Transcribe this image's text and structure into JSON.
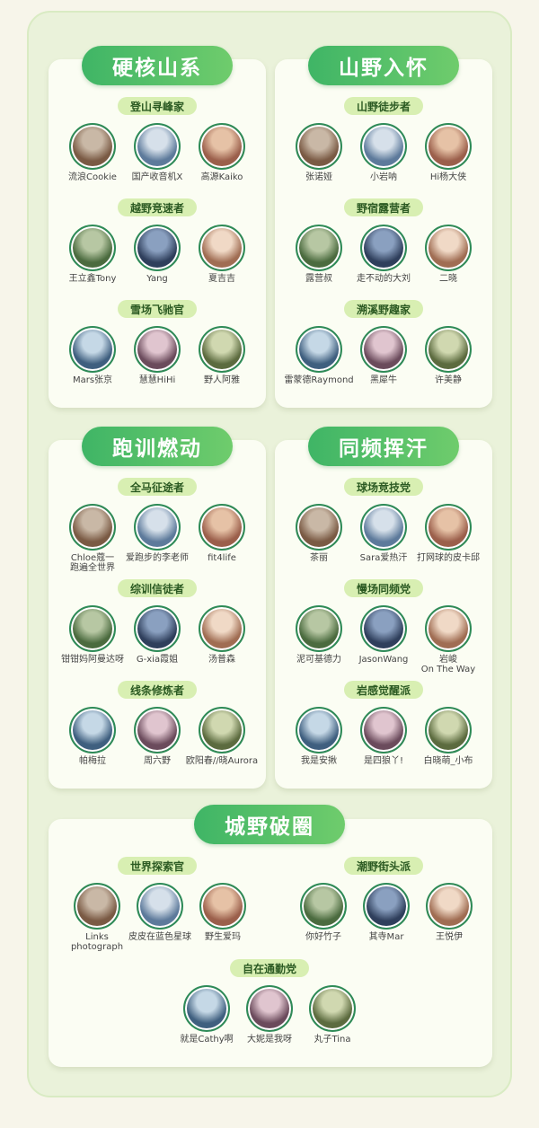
{
  "sections": [
    {
      "title": "硬核山系",
      "groups": [
        {
          "label": "登山寻峰家",
          "people": [
            "流浪Cookie",
            "国产收音机X",
            "高源Kaiko"
          ]
        },
        {
          "label": "越野竞速者",
          "people": [
            "王立鑫Tony",
            "Yang",
            "夏吉吉"
          ]
        },
        {
          "label": "雪场飞驰官",
          "people": [
            "Mars张京",
            "慧慧HiHi",
            "野人阿雅"
          ]
        }
      ]
    },
    {
      "title": "山野入怀",
      "groups": [
        {
          "label": "山野徒步者",
          "people": [
            "张诺娅",
            "小岩呐",
            "Hi杨大侠"
          ]
        },
        {
          "label": "野宿露营者",
          "people": [
            "露营叔",
            "走不动的大刘",
            "二晓"
          ]
        },
        {
          "label": "溯溪野趣家",
          "people": [
            "雷蒙德Raymond",
            "黑犀牛",
            "许美静"
          ]
        }
      ]
    },
    {
      "title": "跑训燃动",
      "groups": [
        {
          "label": "全马征途者",
          "people": [
            "Chloe蔻一\n跑遍全世界",
            "爱跑步的李老师",
            "fit4life"
          ]
        },
        {
          "label": "综训信徒者",
          "people": [
            "钳钳妈阿曼达呀",
            "G-xia霞姐",
            "汤普森"
          ]
        },
        {
          "label": "线条修炼者",
          "people": [
            "帕梅拉",
            "周六野",
            "欧阳春//晓Aurora"
          ]
        }
      ]
    },
    {
      "title": "同频挥汗",
      "groups": [
        {
          "label": "球场竞技党",
          "people": [
            "茶丽",
            "Sara爱热汗",
            "打网球的皮卡邱"
          ]
        },
        {
          "label": "慢场同频党",
          "people": [
            "泥可基德力",
            "JasonWang",
            "岩峻\nOn The Way"
          ]
        },
        {
          "label": "岩感觉醒派",
          "people": [
            "我是安揪",
            "是四狼丫!",
            "白晓萌_小布"
          ]
        }
      ]
    },
    {
      "title": "城野破圈",
      "groups": [
        {
          "label": "世界探索官",
          "people": [
            "Links\nphotograph",
            "皮皮在蓝色星球",
            "野生爱玛"
          ]
        },
        {
          "label": "潮野街头派",
          "people": [
            "你好竹子",
            "其寺Mar",
            "王悦伊"
          ]
        },
        {
          "label": "自在通勤党",
          "people": [
            "就是Cathy啊",
            "大妮是我呀",
            "丸子Tina"
          ]
        }
      ]
    }
  ]
}
